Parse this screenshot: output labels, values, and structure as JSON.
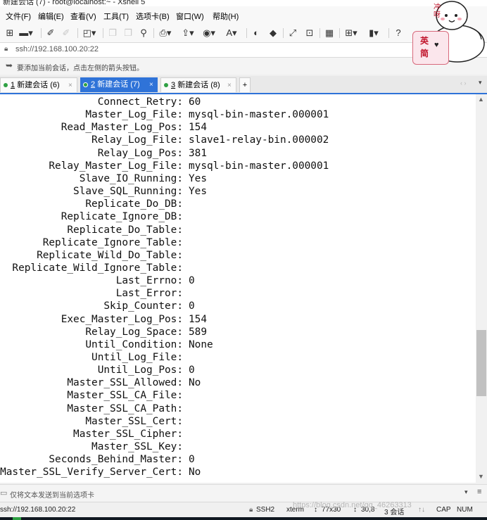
{
  "window": {
    "title": "新建会话 (7) - root@localhost:~ - Xshell 5"
  },
  "menu": [
    "文件(F)",
    "编辑(E)",
    "查看(V)",
    "工具(T)",
    "选项卡(B)",
    "窗口(W)",
    "帮助(H)"
  ],
  "address": {
    "url": "ssh://192.168.100.20:22"
  },
  "hint": {
    "text": "要添加当前会话，点击左侧的箭头按钮。"
  },
  "tabs": [
    {
      "index": "1",
      "label": "新建会话 (6)",
      "dot_color": "#2ea043"
    },
    {
      "index": "2",
      "label": "新建会话 (7)",
      "dot_color": "#2ea043"
    },
    {
      "index": "3",
      "label": "新建会话 (8)",
      "dot_color": "#2ea043"
    }
  ],
  "tab_add": "+",
  "terminal": {
    "keys": [
      "Connect_Retry:",
      "Master_Log_File:",
      "Read_Master_Log_Pos:",
      "Relay_Log_File:",
      "Relay_Log_Pos:",
      "Relay_Master_Log_File:",
      "Slave_IO_Running:",
      "Slave_SQL_Running:",
      "Replicate_Do_DB:",
      "Replicate_Ignore_DB:",
      "Replicate_Do_Table:",
      "Replicate_Ignore_Table:",
      "Replicate_Wild_Do_Table:",
      "Replicate_Wild_Ignore_Table:",
      "Last_Errno:",
      "Last_Error:",
      "Skip_Counter:",
      "Exec_Master_Log_Pos:",
      "Relay_Log_Space:",
      "Until_Condition:",
      "Until_Log_File:",
      "Until_Log_Pos:",
      "Master_SSL_Allowed:",
      "Master_SSL_CA_File:",
      "Master_SSL_CA_Path:",
      "Master_SSL_Cert:",
      "Master_SSL_Cipher:",
      "Master_SSL_Key:",
      "Seconds_Behind_Master:",
      "Master_SSL_Verify_Server_Cert:"
    ],
    "values": [
      "60",
      "mysql-bin-master.000001",
      "154",
      "slave1-relay-bin.000002",
      "381",
      "mysql-bin-master.000001",
      "Yes",
      "Yes",
      "",
      "",
      "",
      "",
      "",
      "",
      "0",
      "",
      "0",
      "154",
      "589",
      "None",
      "",
      "0",
      "No",
      "",
      "",
      "",
      "",
      "",
      "0",
      "No"
    ]
  },
  "compose": {
    "text": "仅将文本发送到当前选项卡"
  },
  "status": {
    "connection": "ssh://192.168.100.20:22",
    "protocol": "SSH2",
    "terminal": "xterm",
    "size": "77x30",
    "cursor": "30,8",
    "sessions": "3 会话",
    "caps": "CAP",
    "num": "NUM"
  },
  "ime": {
    "line1": "英",
    "line2": "简"
  },
  "sticker": {
    "text": "冲\n呀"
  },
  "watermark": "https://blog.csdn.net/qq_46263313"
}
